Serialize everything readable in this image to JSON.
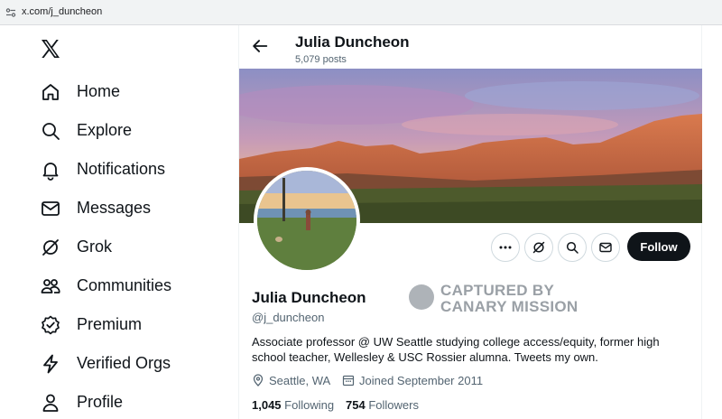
{
  "browser": {
    "url": "x.com/j_duncheon"
  },
  "nav": {
    "items": [
      {
        "label": "Home",
        "icon": "home-icon"
      },
      {
        "label": "Explore",
        "icon": "search-icon"
      },
      {
        "label": "Notifications",
        "icon": "bell-icon"
      },
      {
        "label": "Messages",
        "icon": "envelope-icon"
      },
      {
        "label": "Grok",
        "icon": "grok-icon"
      },
      {
        "label": "Communities",
        "icon": "people-icon"
      },
      {
        "label": "Premium",
        "icon": "verified-badge-icon"
      },
      {
        "label": "Verified Orgs",
        "icon": "lightning-icon"
      },
      {
        "label": "Profile",
        "icon": "person-icon"
      }
    ]
  },
  "header": {
    "name": "Julia Duncheon",
    "posts": "5,079 posts"
  },
  "profile": {
    "name": "Julia Duncheon",
    "handle": "@j_duncheon",
    "bio": "Associate professor @ UW Seattle studying college access/equity, former high school teacher, Wellesley & USC Rossier alumna. Tweets my own.",
    "location": "Seattle, WA",
    "joined": "Joined September 2011",
    "following_count": "1,045",
    "following_label": "Following",
    "followers_count": "754",
    "followers_label": "Followers"
  },
  "actions": {
    "follow_label": "Follow"
  },
  "watermark": {
    "line1": "CAPTURED BY",
    "line2": "CANARY MISSION"
  },
  "colors": {
    "text": "#0f1419",
    "secondary": "#536471",
    "follow_bg": "#0f1419",
    "border": "#cfd9de"
  }
}
